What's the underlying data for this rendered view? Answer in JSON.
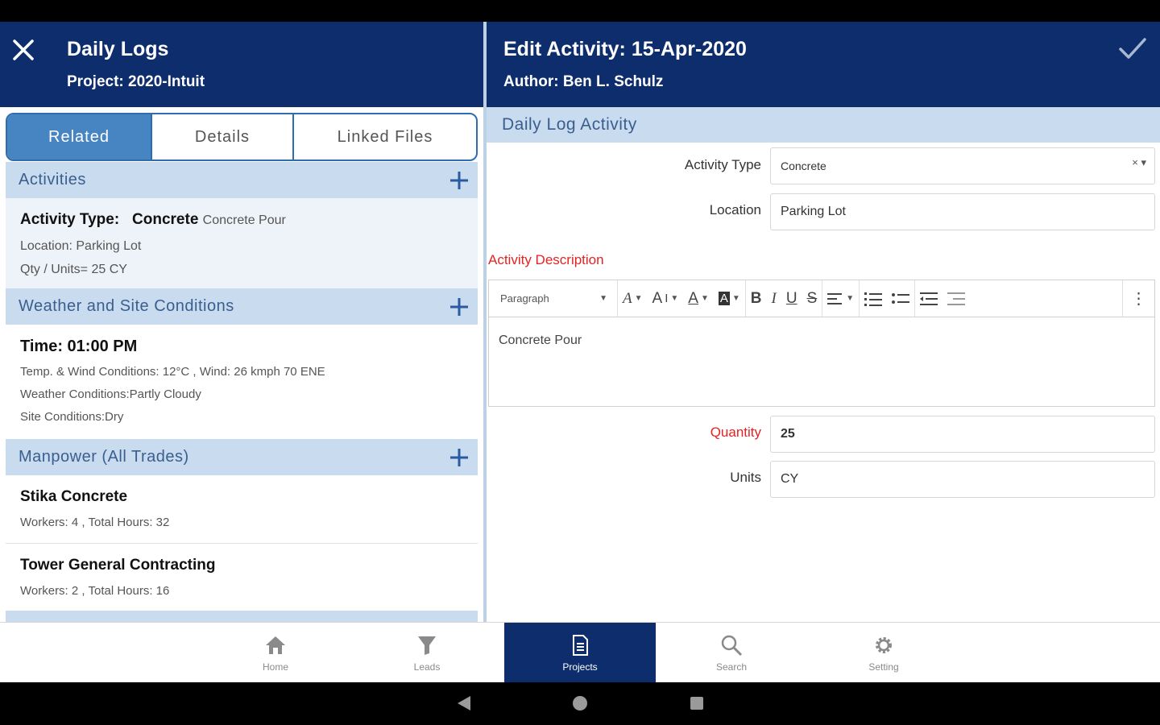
{
  "left_header": {
    "title": "Daily Logs",
    "subtitle": "Project: 2020-Intuit"
  },
  "right_header": {
    "title": "Edit Activity: 15-Apr-2020",
    "subtitle": "Author: Ben L. Schulz"
  },
  "tabs": [
    {
      "label": "Related"
    },
    {
      "label": "Details"
    },
    {
      "label": "Linked Files"
    }
  ],
  "activities": {
    "header": "Activities",
    "type_label": "Activity Type:",
    "type_value": "Concrete",
    "type_desc": "Concrete Pour",
    "location": "Location:   Parking Lot",
    "qty": "Qty / Units= 25 CY"
  },
  "weather": {
    "header": "Weather and Site Conditions",
    "time": "Time: 01:00 PM",
    "temp": "Temp. & Wind Conditions: 12°C , Wind: 26 kmph 70 ENE",
    "conditions": "Weather Conditions:Partly Cloudy",
    "site": "Site Conditions:Dry"
  },
  "manpower": {
    "header": "Manpower (All Trades)",
    "items": [
      {
        "name": "Stika Concrete",
        "detail": "Workers: 4 , Total Hours: 32"
      },
      {
        "name": "Tower General Contracting",
        "detail": "Workers: 2 , Total Hours: 16"
      }
    ]
  },
  "form": {
    "header": "Daily Log Activity",
    "activity_type_label": "Activity Type",
    "activity_type_value": "Concrete",
    "select_clear": "×",
    "select_caret": "▾",
    "location_label": "Location",
    "location_value": "Parking Lot",
    "description_label": "Activity Description",
    "paragraph_format": "Paragraph",
    "description_value": "Concrete Pour",
    "quantity_label": "Quantity",
    "quantity_value": "25",
    "units_label": "Units",
    "units_value": "CY"
  },
  "nav": [
    {
      "label": "Home",
      "icon": "home-icon"
    },
    {
      "label": "Leads",
      "icon": "funnel-icon"
    },
    {
      "label": "Projects",
      "icon": "document-icon",
      "active": true
    },
    {
      "label": "Search",
      "icon": "search-icon"
    },
    {
      "label": "Setting",
      "icon": "gear-icon"
    }
  ],
  "colors": {
    "header_bg": "#0d2d6c",
    "section_bg": "#c9dbef",
    "tab_active": "#4684c2",
    "required": "#e52222"
  }
}
